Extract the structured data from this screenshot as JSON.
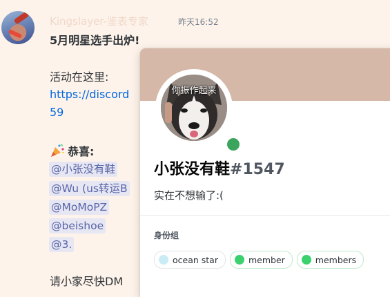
{
  "message": {
    "author": "Kingslayer-鉴表专家",
    "time": "昨天16:52",
    "title": "5月明星选手出炉!",
    "activity_label": "活动在这里:",
    "link_partial": "https://discord",
    "link_tail": "59",
    "congrats_label": "恭喜:",
    "mentions": [
      "@小张没有鞋",
      "@Wu (us转运B",
      "@MoMoPZ",
      "@beishoe",
      "@3."
    ],
    "trailing_partial": "请小家尽快DM"
  },
  "profile": {
    "avatar_caption": "你振作起来",
    "display_name": "小张没有鞋",
    "discriminator": "#1547",
    "custom_status": "实在不想输了:(",
    "roles_heading": "身份组",
    "roles": [
      {
        "name": "ocean star",
        "color": "#c9ecf5"
      },
      {
        "name": "member",
        "color": "#3bd16f"
      },
      {
        "name": "members",
        "color": "#3bd16f"
      }
    ],
    "online_color": "#3ba55d",
    "banner_color": "#d6b8a8"
  }
}
